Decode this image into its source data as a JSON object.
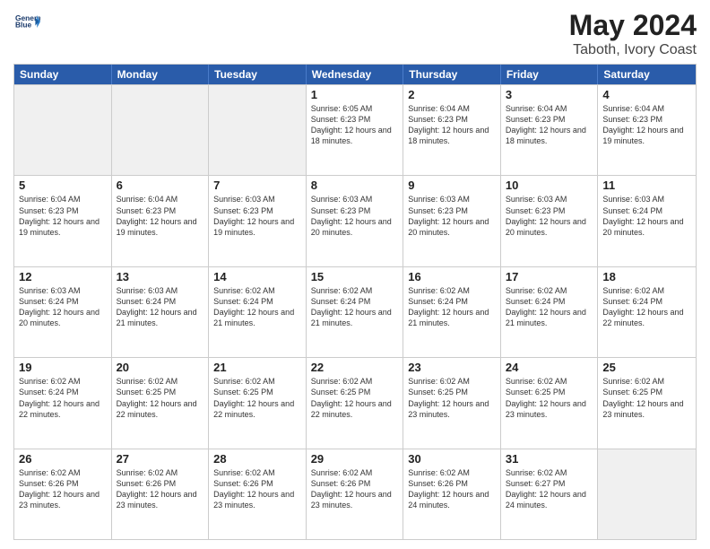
{
  "logo": {
    "line1": "General",
    "line2": "Blue"
  },
  "title": "May 2024",
  "location": "Taboth, Ivory Coast",
  "header_days": [
    "Sunday",
    "Monday",
    "Tuesday",
    "Wednesday",
    "Thursday",
    "Friday",
    "Saturday"
  ],
  "rows": [
    [
      {
        "day": "",
        "text": ""
      },
      {
        "day": "",
        "text": ""
      },
      {
        "day": "",
        "text": ""
      },
      {
        "day": "1",
        "text": "Sunrise: 6:05 AM\nSunset: 6:23 PM\nDaylight: 12 hours\nand 18 minutes."
      },
      {
        "day": "2",
        "text": "Sunrise: 6:04 AM\nSunset: 6:23 PM\nDaylight: 12 hours\nand 18 minutes."
      },
      {
        "day": "3",
        "text": "Sunrise: 6:04 AM\nSunset: 6:23 PM\nDaylight: 12 hours\nand 18 minutes."
      },
      {
        "day": "4",
        "text": "Sunrise: 6:04 AM\nSunset: 6:23 PM\nDaylight: 12 hours\nand 19 minutes."
      }
    ],
    [
      {
        "day": "5",
        "text": "Sunrise: 6:04 AM\nSunset: 6:23 PM\nDaylight: 12 hours\nand 19 minutes."
      },
      {
        "day": "6",
        "text": "Sunrise: 6:04 AM\nSunset: 6:23 PM\nDaylight: 12 hours\nand 19 minutes."
      },
      {
        "day": "7",
        "text": "Sunrise: 6:03 AM\nSunset: 6:23 PM\nDaylight: 12 hours\nand 19 minutes."
      },
      {
        "day": "8",
        "text": "Sunrise: 6:03 AM\nSunset: 6:23 PM\nDaylight: 12 hours\nand 20 minutes."
      },
      {
        "day": "9",
        "text": "Sunrise: 6:03 AM\nSunset: 6:23 PM\nDaylight: 12 hours\nand 20 minutes."
      },
      {
        "day": "10",
        "text": "Sunrise: 6:03 AM\nSunset: 6:23 PM\nDaylight: 12 hours\nand 20 minutes."
      },
      {
        "day": "11",
        "text": "Sunrise: 6:03 AM\nSunset: 6:24 PM\nDaylight: 12 hours\nand 20 minutes."
      }
    ],
    [
      {
        "day": "12",
        "text": "Sunrise: 6:03 AM\nSunset: 6:24 PM\nDaylight: 12 hours\nand 20 minutes."
      },
      {
        "day": "13",
        "text": "Sunrise: 6:03 AM\nSunset: 6:24 PM\nDaylight: 12 hours\nand 21 minutes."
      },
      {
        "day": "14",
        "text": "Sunrise: 6:02 AM\nSunset: 6:24 PM\nDaylight: 12 hours\nand 21 minutes."
      },
      {
        "day": "15",
        "text": "Sunrise: 6:02 AM\nSunset: 6:24 PM\nDaylight: 12 hours\nand 21 minutes."
      },
      {
        "day": "16",
        "text": "Sunrise: 6:02 AM\nSunset: 6:24 PM\nDaylight: 12 hours\nand 21 minutes."
      },
      {
        "day": "17",
        "text": "Sunrise: 6:02 AM\nSunset: 6:24 PM\nDaylight: 12 hours\nand 21 minutes."
      },
      {
        "day": "18",
        "text": "Sunrise: 6:02 AM\nSunset: 6:24 PM\nDaylight: 12 hours\nand 22 minutes."
      }
    ],
    [
      {
        "day": "19",
        "text": "Sunrise: 6:02 AM\nSunset: 6:24 PM\nDaylight: 12 hours\nand 22 minutes."
      },
      {
        "day": "20",
        "text": "Sunrise: 6:02 AM\nSunset: 6:25 PM\nDaylight: 12 hours\nand 22 minutes."
      },
      {
        "day": "21",
        "text": "Sunrise: 6:02 AM\nSunset: 6:25 PM\nDaylight: 12 hours\nand 22 minutes."
      },
      {
        "day": "22",
        "text": "Sunrise: 6:02 AM\nSunset: 6:25 PM\nDaylight: 12 hours\nand 22 minutes."
      },
      {
        "day": "23",
        "text": "Sunrise: 6:02 AM\nSunset: 6:25 PM\nDaylight: 12 hours\nand 23 minutes."
      },
      {
        "day": "24",
        "text": "Sunrise: 6:02 AM\nSunset: 6:25 PM\nDaylight: 12 hours\nand 23 minutes."
      },
      {
        "day": "25",
        "text": "Sunrise: 6:02 AM\nSunset: 6:25 PM\nDaylight: 12 hours\nand 23 minutes."
      }
    ],
    [
      {
        "day": "26",
        "text": "Sunrise: 6:02 AM\nSunset: 6:26 PM\nDaylight: 12 hours\nand 23 minutes."
      },
      {
        "day": "27",
        "text": "Sunrise: 6:02 AM\nSunset: 6:26 PM\nDaylight: 12 hours\nand 23 minutes."
      },
      {
        "day": "28",
        "text": "Sunrise: 6:02 AM\nSunset: 6:26 PM\nDaylight: 12 hours\nand 23 minutes."
      },
      {
        "day": "29",
        "text": "Sunrise: 6:02 AM\nSunset: 6:26 PM\nDaylight: 12 hours\nand 23 minutes."
      },
      {
        "day": "30",
        "text": "Sunrise: 6:02 AM\nSunset: 6:26 PM\nDaylight: 12 hours\nand 24 minutes."
      },
      {
        "day": "31",
        "text": "Sunrise: 6:02 AM\nSunset: 6:27 PM\nDaylight: 12 hours\nand 24 minutes."
      },
      {
        "day": "",
        "text": ""
      }
    ]
  ]
}
